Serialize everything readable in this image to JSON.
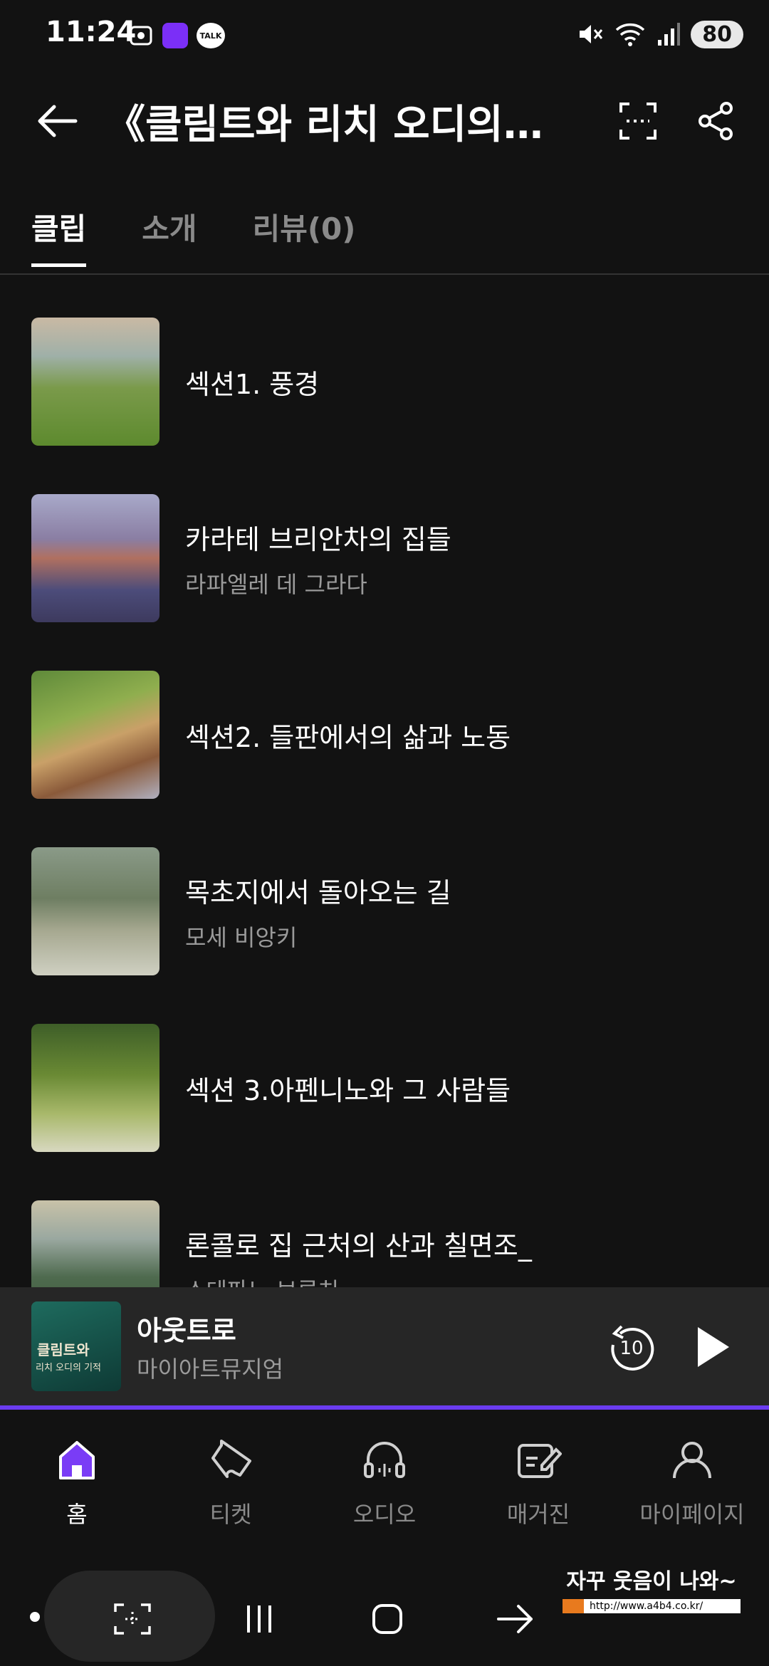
{
  "status_bar": {
    "time": "11:24",
    "battery": "80",
    "talk_badge": "TALK"
  },
  "header": {
    "title": "《클림트와 리치 오디의 ..."
  },
  "tabs": [
    {
      "label": "클립",
      "active": true
    },
    {
      "label": "소개",
      "active": false
    },
    {
      "label": "리뷰(0)",
      "active": false
    }
  ],
  "clips": [
    {
      "title": "섹션1. 풍경",
      "subtitle": ""
    },
    {
      "title": "카라테 브리안차의 집들",
      "subtitle": "라파엘레 데 그라다"
    },
    {
      "title": "섹션2. 들판에서의 삶과 노동",
      "subtitle": ""
    },
    {
      "title": "목초지에서 돌아오는 길",
      "subtitle": "모세 비앙키"
    },
    {
      "title": "섹션 3.아펜니노와 그 사람들",
      "subtitle": ""
    },
    {
      "title": "론콜로 집 근처의 산과 칠면조_",
      "subtitle": "스테파노 브루치"
    }
  ],
  "player": {
    "title": "아웃트로",
    "subtitle": "마이아트뮤지엄",
    "cover_text_1": "클림트와",
    "cover_text_2": "리치 오디의 기적",
    "rewind_label": "10",
    "accent": "#6b3cf0"
  },
  "bottom_nav": [
    {
      "label": "홈",
      "icon": "home-icon",
      "active": true
    },
    {
      "label": "티켓",
      "icon": "ticket-icon",
      "active": false
    },
    {
      "label": "오디오",
      "icon": "headphones-icon",
      "active": false
    },
    {
      "label": "매거진",
      "icon": "magazine-edit-icon",
      "active": false
    },
    {
      "label": "마이페이지",
      "icon": "person-icon",
      "active": false
    }
  ],
  "watermark": {
    "text": "자꾸 웃음이 나와~",
    "url": "http://www.a4b4.co.kr/"
  }
}
